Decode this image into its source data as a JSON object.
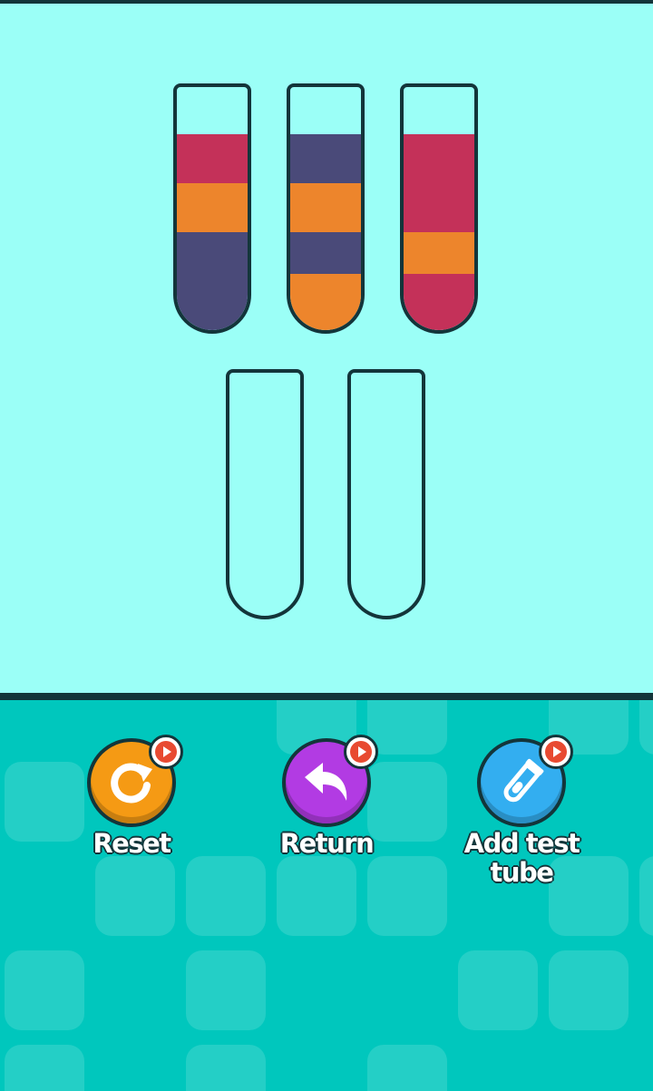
{
  "colors": {
    "board_bg": "#9bfff7",
    "panel_bg": "#00c7bd",
    "outline": "#13353a",
    "red": "#c43159",
    "orange": "#ed852c",
    "navy": "#4a4a79",
    "reset_button": "#f59a14",
    "return_button": "#b23be3",
    "add_tube_button": "#33aef0",
    "badge_play": "#e84a31"
  },
  "tubes": [
    {
      "layers_top_to_bottom": [
        "red",
        "orange",
        "navy",
        "navy"
      ]
    },
    {
      "layers_top_to_bottom": [
        "navy",
        "orange",
        "navy",
        "orange"
      ]
    },
    {
      "layers_top_to_bottom": [
        "red",
        "red",
        "orange",
        "red"
      ]
    },
    {
      "layers_top_to_bottom": []
    },
    {
      "layers_top_to_bottom": []
    }
  ],
  "toolbar": {
    "reset": {
      "label": "Reset",
      "icon": "reset-icon",
      "badge_icon": "video-ad-icon"
    },
    "return": {
      "label": "Return",
      "icon": "undo-arrow-icon",
      "badge_icon": "video-ad-icon"
    },
    "add_tube": {
      "label_line1": "Add test",
      "label_line2": "tube",
      "icon": "test-tube-icon",
      "badge_icon": "video-ad-icon"
    }
  }
}
